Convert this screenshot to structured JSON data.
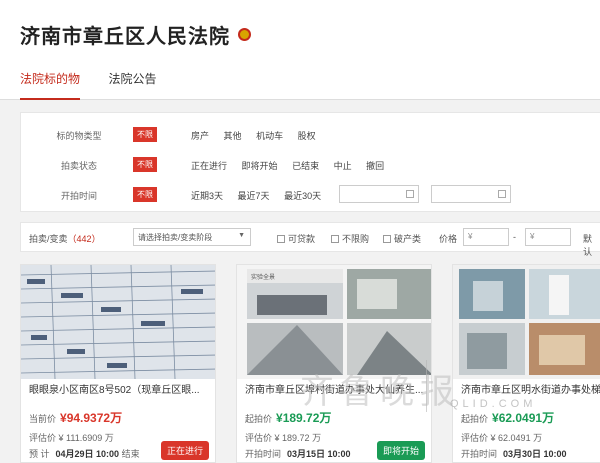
{
  "header": {
    "title": "济南市章丘区人民法院"
  },
  "tabs": [
    {
      "label": "法院标的物",
      "active": true
    },
    {
      "label": "法院公告",
      "active": false
    }
  ],
  "filters": [
    {
      "label": "标的物类型",
      "badge": "不限",
      "options": [
        "房产",
        "其他",
        "机动车",
        "股权"
      ]
    },
    {
      "label": "拍卖状态",
      "badge": "不限",
      "options": [
        "正在进行",
        "即将开始",
        "已结束",
        "中止",
        "撤回"
      ]
    },
    {
      "label": "开拍时间",
      "badge": "不限",
      "options": [
        "近期3天",
        "最近7天",
        "最近30天"
      ]
    }
  ],
  "date_separator": "-",
  "sortbar": {
    "count_label": "拍卖/变卖",
    "count_value": "442",
    "stage_select": "请选择拍卖/变卖阶段",
    "check1": "可贷款",
    "check2": "不限购",
    "check3": "破产类",
    "price_label": "价格",
    "price_from": "¥",
    "price_sep": "-",
    "price_to": "¥",
    "confirm": "默认"
  },
  "cards": [
    {
      "title": "眼眼泉小区南区8号502（现章丘区眼...",
      "current_label": "当前价",
      "current_price": "¥94.9372万",
      "appraisal_label": "评估价",
      "appraisal_price": "¥ 111.6909 万",
      "time_label": "预  计",
      "time_value": "04月29日 10:00",
      "time_suffix": "结束",
      "status": "正在进行",
      "status_color": "#d9362a",
      "price_color": "red"
    },
    {
      "title": "济南市章丘区埠村街道办事处大仙养生...",
      "current_label": "起拍价",
      "current_price": "¥189.72万",
      "appraisal_label": "评估价",
      "appraisal_price": "¥ 189.72 万",
      "time_label": "开拍时间",
      "time_value": "03月15日 10:00",
      "time_suffix": "",
      "status": "即将开始",
      "status_color": "#1a9b55",
      "price_color": "green"
    },
    {
      "title": "济南市章丘区明水街道办事处梯子...",
      "current_label": "起拍价",
      "current_price": "¥62.0491万",
      "appraisal_label": "评估价",
      "appraisal_price": "¥ 62.0491 万",
      "time_label": "开拍时间",
      "time_value": "03月30日 10:00",
      "time_suffix": "",
      "status": "",
      "status_color": "#1a9b55",
      "price_color": "green"
    }
  ],
  "watermark": {
    "main": "齐鲁晚报",
    "sub": "QLID.COM"
  },
  "colors": {
    "accent": "#c42b1c",
    "badge": "#d9362a",
    "green": "#1a9b55"
  }
}
